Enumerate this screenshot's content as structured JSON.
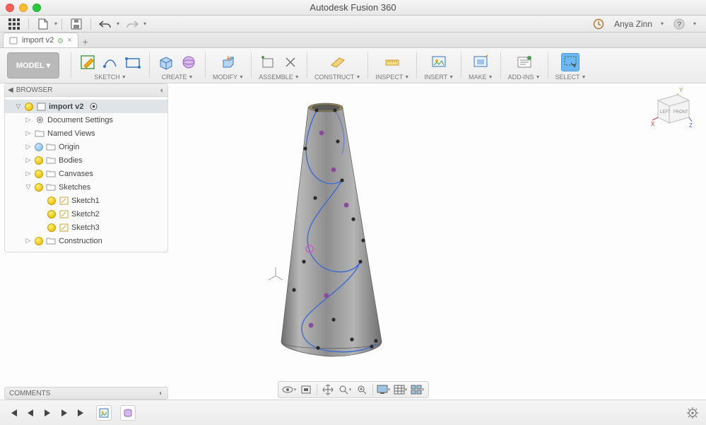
{
  "app": {
    "title": "Autodesk Fusion 360"
  },
  "user": {
    "name": "Anya Zinn"
  },
  "document": {
    "tab_label": "import v2"
  },
  "workspace": {
    "label": "MODEL",
    "caret": "▾"
  },
  "ribbon": {
    "sketch": {
      "label": "SKETCH"
    },
    "create": {
      "label": "CREATE"
    },
    "modify": {
      "label": "MODIFY"
    },
    "assemble": {
      "label": "ASSEMBLE"
    },
    "construct": {
      "label": "CONSTRUCT"
    },
    "inspect": {
      "label": "INSPECT"
    },
    "insert": {
      "label": "INSERT"
    },
    "make": {
      "label": "MAKE"
    },
    "addins": {
      "label": "ADD-INS"
    },
    "select": {
      "label": "SELECT"
    }
  },
  "browser": {
    "title": "BROWSER",
    "root": "import v2",
    "items": {
      "docset": "Document Settings",
      "views": "Named Views",
      "origin": "Origin",
      "bodies": "Bodies",
      "canvases": "Canvases",
      "sketches": "Sketches",
      "sk1": "Sketch1",
      "sk2": "Sketch2",
      "sk3": "Sketch3",
      "constr": "Construction"
    }
  },
  "comments": {
    "title": "COMMENTS"
  },
  "viewcube": {
    "left": "LEFT",
    "front": "FRONT",
    "axes": {
      "x": "X",
      "y": "Y",
      "z": "Z"
    }
  }
}
